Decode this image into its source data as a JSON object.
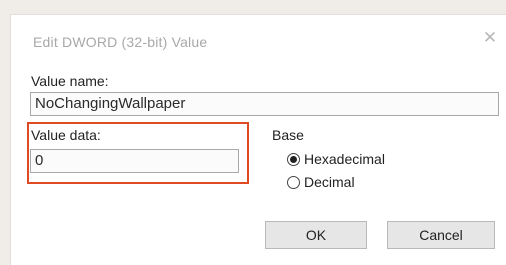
{
  "dialog": {
    "title": "Edit DWORD (32-bit) Value",
    "close_glyph": "✕",
    "close_icon": "close-icon"
  },
  "value_name": {
    "label": "Value name:",
    "value": "NoChangingWallpaper"
  },
  "value_data": {
    "label": "Value data:",
    "value": "0",
    "highlight_color": "#e04a22"
  },
  "base": {
    "label": "Base",
    "options": [
      {
        "label": "Hexadecimal",
        "selected": true
      },
      {
        "label": "Decimal",
        "selected": false
      }
    ]
  },
  "buttons": {
    "ok_label": "OK",
    "cancel_label": "Cancel"
  }
}
